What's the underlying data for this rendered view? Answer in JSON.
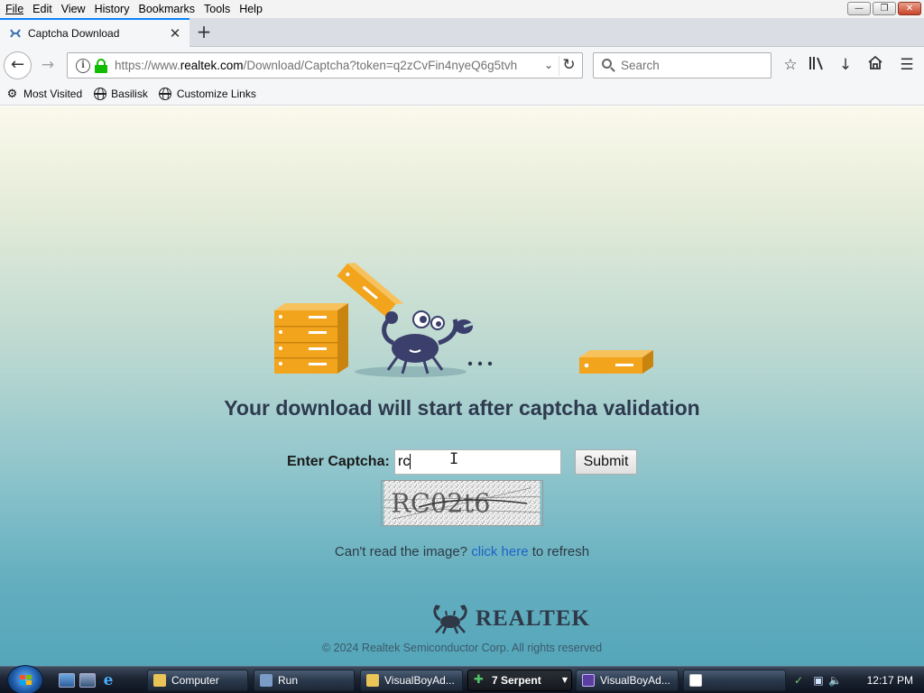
{
  "menu": [
    "File",
    "Edit",
    "View",
    "History",
    "Bookmarks",
    "Tools",
    "Help"
  ],
  "tab": {
    "title": "Captcha Download"
  },
  "nav": {
    "url_prefix": "https://www.",
    "url_host": "realtek.com",
    "url_rest": "/Download/Captcha?token=q2zCvFin4nyeQ6g5tvh",
    "search_placeholder": "Search"
  },
  "bookmarks": [
    "Most Visited",
    "Basilisk",
    "Customize Links"
  ],
  "page": {
    "headline": "Your download will start after captcha validation",
    "captcha_label": "Enter Captcha:",
    "captcha_value": "rc",
    "submit_label": "Submit",
    "captcha_image_text": "RC02t6",
    "refresh_prefix": "Can't read the image?",
    "refresh_link": "click here",
    "refresh_suffix": "to refresh",
    "brand": "REALTEK",
    "copyright": "© 2024 Realtek Semiconductor Corp. All rights reserved"
  },
  "taskbar": {
    "buttons": [
      "Computer",
      "Run",
      "VisualBoyAd...",
      "7 Serpent",
      "VisualBoyAd...",
      ""
    ],
    "clock": "12:17 PM"
  },
  "colors": {
    "accent_tab": "#0a84ff",
    "headline": "#2d3a4f",
    "link": "#1c64c8",
    "server_orange": "#f2a41c",
    "crab": "#3b3f6b"
  }
}
